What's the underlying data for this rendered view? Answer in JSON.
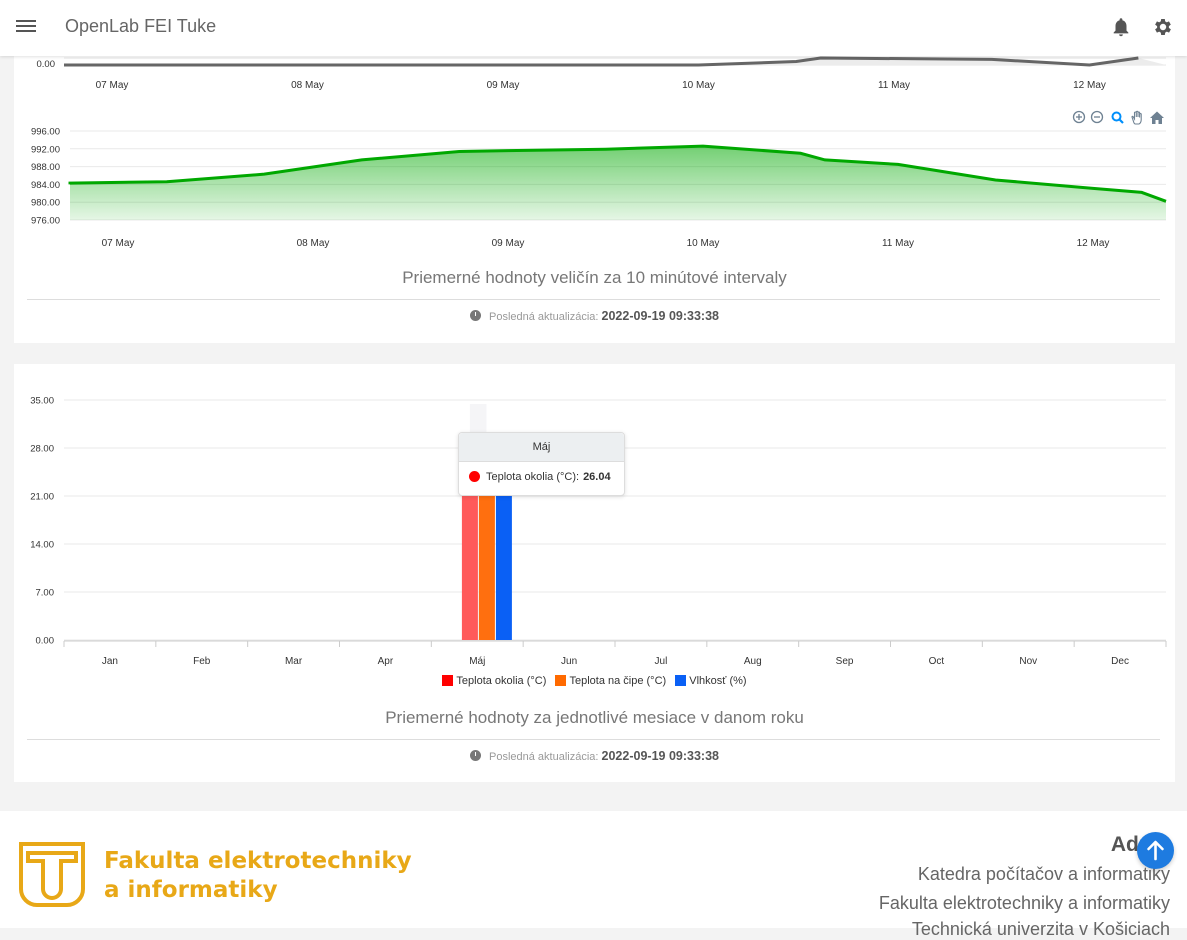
{
  "header": {
    "title": "OpenLab FEI Tuke",
    "menu_icon": "hamburger-menu-icon",
    "bell_icon": "bell-icon",
    "settings_icon": "gear-icon"
  },
  "colors": {
    "green_line": "#00a800",
    "bar_red": "#ff5a5a",
    "bar_orange": "#ff6f0f",
    "bar_blue": "#0a60f5",
    "accent_footer": "#e8a817",
    "scroll_button": "#1e7be0"
  },
  "chart_data": [
    {
      "type": "line",
      "x_ticks": [
        "07 May",
        "08 May",
        "09 May",
        "10 May",
        "11 May",
        "12 May"
      ],
      "y_ticks": [
        "0.00"
      ],
      "visible_partial": true,
      "x": [
        "06 May 18:00",
        "10 May 00:00",
        "10 May 12:00",
        "10 May 15:00",
        "11 May 12:00",
        "12 May 00:00",
        "12 May 06:00"
      ],
      "y": [
        0,
        0,
        0.5,
        1,
        0.8,
        0,
        1
      ]
    },
    {
      "type": "area",
      "x_ticks": [
        "07 May",
        "08 May",
        "09 May",
        "10 May",
        "11 May",
        "12 May"
      ],
      "y_ticks": [
        "976.00",
        "980.00",
        "984.00",
        "988.00",
        "992.00",
        "996.00"
      ],
      "ylim": [
        976,
        996
      ],
      "toolbar": [
        "zoom-in-icon",
        "zoom-out-icon",
        "magnifier-icon",
        "pan-hand-icon",
        "home-icon"
      ],
      "x": [
        "06 May 12:00",
        "06 May 18:00",
        "07 May 06:00",
        "07 May 18:00",
        "08 May 06:00",
        "08 May 18:00",
        "09 May 00:00",
        "09 May 12:00",
        "10 May 00:00",
        "10 May 12:00",
        "10 May 15:00",
        "11 May 00:00",
        "11 May 12:00",
        "12 May 00:00",
        "12 May 06:00",
        "12 May 12:00"
      ],
      "y": [
        984,
        984.3,
        984.6,
        986.3,
        989.5,
        991.4,
        991.6,
        991.9,
        992.6,
        991,
        989.5,
        988.5,
        985,
        983.1,
        982.2,
        980.2
      ]
    },
    {
      "type": "bar",
      "categories": [
        "Jan",
        "Feb",
        "Mar",
        "Apr",
        "Máj",
        "Jun",
        "Jul",
        "Aug",
        "Sep",
        "Oct",
        "Nov",
        "Dec"
      ],
      "y_ticks": [
        "0.00",
        "7.00",
        "14.00",
        "21.00",
        "28.00",
        "35.00"
      ],
      "ylim": [
        0,
        35
      ],
      "series": [
        {
          "name": "Teplota okolia (°C)",
          "color": "#ff5a5a",
          "values": [
            null,
            null,
            null,
            null,
            26.04,
            null,
            null,
            null,
            null,
            null,
            null,
            null
          ]
        },
        {
          "name": "Teplota na čipe (°C)",
          "color": "#ff6f0f",
          "values": [
            null,
            null,
            null,
            null,
            26.5,
            null,
            null,
            null,
            null,
            null,
            null,
            null
          ]
        },
        {
          "name": "Vlhkosť (%)",
          "color": "#0a60f5",
          "values": [
            null,
            null,
            null,
            null,
            26.5,
            null,
            null,
            null,
            null,
            null,
            null,
            null
          ]
        }
      ],
      "tooltip": {
        "title": "Máj",
        "label": "Teplota okolia (°C):",
        "value": "26.04"
      }
    }
  ],
  "card1": {
    "caption": "Priemerné hodnoty veličín za 10 minútové intervaly",
    "update_label": "Posledná aktualizácia:",
    "update_value": "2022-09-19 09:33:38"
  },
  "card2": {
    "caption": "Priemerné hodnoty za jednotlivé mesiace v danom roku",
    "update_label": "Posledná aktualizácia:",
    "update_value": "2022-09-19 09:33:38"
  },
  "footer": {
    "faculty_line1": "Fakulta elektrotechniky",
    "faculty_line2": "a informatiky",
    "address_title": "Adr",
    "address_lines": [
      "Katedra počítačov a informatiky",
      "Fakulta elektrotechniky a informatiky",
      "Technická univerzita v Košiciach"
    ]
  },
  "scroll_top_icon": "arrow-up-icon"
}
